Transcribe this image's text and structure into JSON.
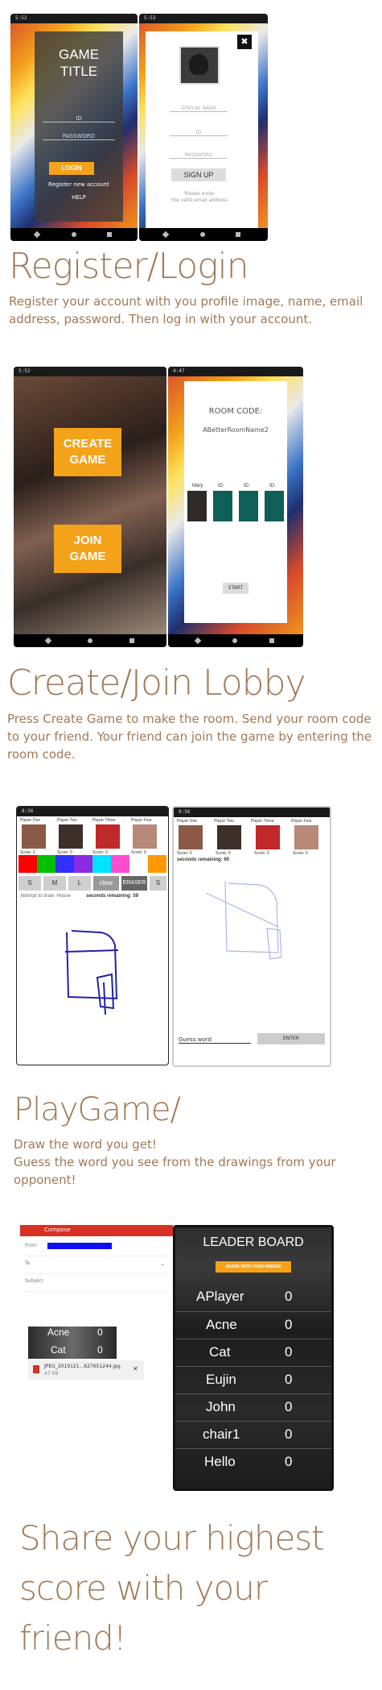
{
  "section1": {
    "heading": "Register/Login",
    "description": "Register your account with you profile image, name, email address, password. Then log in with your account.",
    "login_screen": {
      "status": "5:52",
      "game_title_line1": "GAME",
      "game_title_line2": "TITLE",
      "id_placeholder": "ID",
      "password_placeholder": "PASSWORD",
      "login_button": "LOGIN",
      "register_link": "Register new account",
      "help_link": "HELP"
    },
    "signup_screen": {
      "status": "5:53",
      "close_label": "✖",
      "display_name_placeholder": "DISPLAY NAME",
      "id_placeholder": "ID",
      "password_placeholder": "PASSWORD",
      "signup_button": "SIGN UP",
      "hint_line1": "Please enter",
      "hint_line2": "the valid email address"
    }
  },
  "section2": {
    "heading": "Create/Join Lobby",
    "description": "Press Create Game to make the room. Send your room code to your friend. Your friend can join the game by entering the room code.",
    "menu_screen": {
      "status": "5:52",
      "create_line1": "CREATE",
      "create_line2": "GAME",
      "join_line1": "JOIN",
      "join_line2": "GAME"
    },
    "lobby_screen": {
      "status": "4:47",
      "room_code_label": "ROOM CODE:",
      "room_code_value": "ABetterRoomName2",
      "slots": [
        "Mary",
        "ID:",
        "ID:",
        "ID:"
      ],
      "start_button": "START"
    }
  },
  "section3": {
    "heading": "PlayGame/",
    "description_line1": "Draw the word you get!",
    "description_line2": "Guess the word you see from the drawings from your opponent!",
    "draw_screen": {
      "status": "8:56",
      "players": [
        "Player One",
        "Player Two",
        "Player Three",
        "Player Four"
      ],
      "scores": [
        "Score: 0",
        "Score: 0",
        "Score: 0",
        "Score: 0"
      ],
      "tools": [
        "S",
        "M",
        "L",
        "clear",
        "ERASER",
        "S"
      ],
      "attempt_text": "Attempt to draw: House",
      "seconds_text": "seconds remaining: 59"
    },
    "guess_screen": {
      "status": "8:56",
      "players": [
        "Player One",
        "Player Two",
        "Player Three",
        "Player Four"
      ],
      "scores": [
        "Score: 0",
        "Score: 0",
        "Score: 0",
        "Score: 0"
      ],
      "seconds_text": "seconds remaining: 60",
      "guess_placeholder": "Guess word",
      "enter_button": "ENTER"
    }
  },
  "section4": {
    "heading_line1": "Share your highest",
    "heading_line2": "score with your",
    "heading_line3": "friend!",
    "compose_screen": {
      "title": "Compose",
      "from_label": "From",
      "to_label": "To",
      "subject_label": "Subject",
      "preview_rows": [
        {
          "name": "Acne",
          "score": "0"
        },
        {
          "name": "Cat",
          "score": "0"
        }
      ],
      "attachment_name": "JPEG_2019121...627651244.jpg",
      "attachment_size": "47 KB",
      "attachment_close": "✕"
    },
    "leaderboard_screen": {
      "title": "LEADER BOARD",
      "share_button": "SHARE WITH YOUR FRIEND!",
      "rows": [
        {
          "name": "APlayer",
          "score": "0"
        },
        {
          "name": "Acne",
          "score": "0"
        },
        {
          "name": "Cat",
          "score": "0"
        },
        {
          "name": "Eujin",
          "score": "0"
        },
        {
          "name": "John",
          "score": "0"
        },
        {
          "name": "chair1",
          "score": "0"
        },
        {
          "name": "Hello",
          "score": "0"
        }
      ]
    }
  },
  "colors": {
    "text_brown": "#a07a57",
    "button_orange": "#f5a21b",
    "lobby_tile": "#0e5f57",
    "palette": [
      "#ff0000",
      "#00c000",
      "#3030ff",
      "#8a2be2",
      "#00e5ff",
      "#ff4dd2",
      "#ffffff",
      "#ff9800"
    ]
  }
}
